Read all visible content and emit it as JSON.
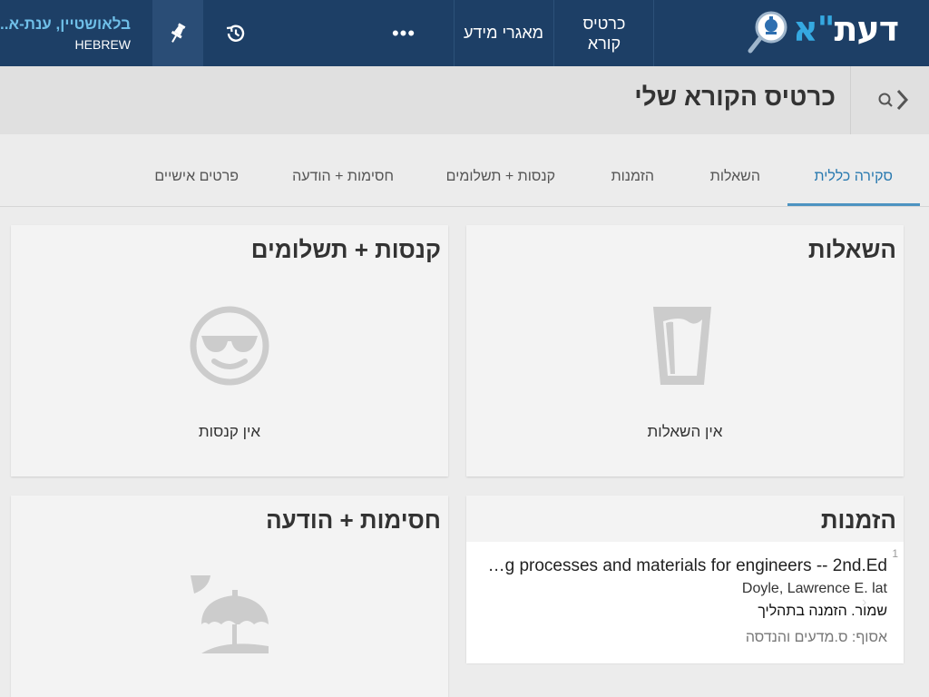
{
  "app": {
    "logo": {
      "main": "דעת",
      "accent": "\"א"
    }
  },
  "nav": {
    "reader_card_line1": "כרטיס",
    "reader_card_line2": "קורא",
    "resources": "מאגרי מידע",
    "more": "•••",
    "user_name": "בלאושטיין, ענת-א...",
    "language": "HEBREW"
  },
  "header": {
    "title": "כרטיס הקורא שלי"
  },
  "tabs": [
    {
      "label": "סקירה כללית",
      "active": true
    },
    {
      "label": "השאלות"
    },
    {
      "label": "הזמנות"
    },
    {
      "label": "קנסות + תשלומים"
    },
    {
      "label": "חסימות + הודעה"
    },
    {
      "label": "פרטים אישיים"
    }
  ],
  "cards": {
    "loans": {
      "title": "השאלות",
      "empty": "אין השאלות"
    },
    "fines": {
      "title": "קנסות + תשלומים",
      "empty": "אין קנסות"
    },
    "requests": {
      "title": "הזמנות",
      "items": [
        {
          "num": "1",
          "title": "…g processes and materials for engineers -- 2nd.Ed",
          "author": "Doyle, Lawrence E. lat",
          "status": "שמור. הזמנה בתהליך",
          "collection": "אסוף: ס.מדעים והנדסה"
        }
      ]
    },
    "blocks": {
      "title": "חסימות + הודעה"
    }
  },
  "colors": {
    "topbar": "#1d3f66",
    "accent": "#35a9e1",
    "tab_active": "#4d93c1",
    "card_bg": "#f3f3f3",
    "icon_gray": "#cccccc"
  },
  "icons": {
    "logo": "magnifier-logo-icon",
    "history": "history-icon",
    "pin": "pin-icon",
    "back": "back-search-icon",
    "loans": "glass-icon",
    "fines": "sunglasses-smiley-icon",
    "blocks": "beach-umbrella-icon"
  }
}
